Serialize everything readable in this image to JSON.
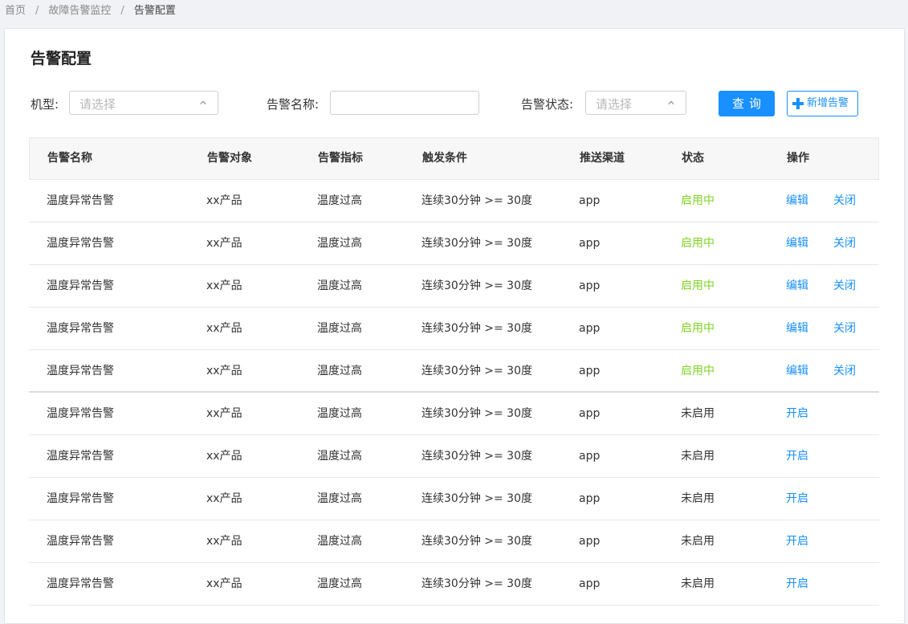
{
  "breadcrumb": {
    "items": [
      "首页",
      "故障告警监控",
      "告警配置"
    ],
    "separator": "/"
  },
  "page": {
    "title": "告警配置"
  },
  "filters": {
    "model_label": "机型:",
    "model_placeholder": "请选择",
    "name_label": "告警名称:",
    "name_value": "",
    "status_label": "告警状态:",
    "status_placeholder": "请选择"
  },
  "buttons": {
    "query": "查询",
    "add": "新增告警"
  },
  "table": {
    "headers": [
      "告警名称",
      "告警对象",
      "告警指标",
      "触发条件",
      "推送渠道",
      "状态",
      "操作"
    ],
    "rows": [
      {
        "name": "温度异常告警",
        "target": "xx产品",
        "metric": "温度过高",
        "condition": "连续30分钟 >= 30度",
        "channel": "app",
        "status": "启用中",
        "action1": "编辑",
        "action2": "关闭"
      },
      {
        "name": "温度异常告警",
        "target": "xx产品",
        "metric": "温度过高",
        "condition": "连续30分钟 >= 30度",
        "channel": "app",
        "status": "启用中",
        "action1": "编辑",
        "action2": "关闭"
      },
      {
        "name": "温度异常告警",
        "target": "xx产品",
        "metric": "温度过高",
        "condition": "连续30分钟 >= 30度",
        "channel": "app",
        "status": "启用中",
        "action1": "编辑",
        "action2": "关闭"
      },
      {
        "name": "温度异常告警",
        "target": "xx产品",
        "metric": "温度过高",
        "condition": "连续30分钟 >= 30度",
        "channel": "app",
        "status": "启用中",
        "action1": "编辑",
        "action2": "关闭"
      },
      {
        "name": "温度异常告警",
        "target": "xx产品",
        "metric": "温度过高",
        "condition": "连续30分钟 >= 30度",
        "channel": "app",
        "status": "启用中",
        "action1": "编辑",
        "action2": "关闭"
      },
      {
        "name": "温度异常告警",
        "target": "xx产品",
        "metric": "温度过高",
        "condition": "连续30分钟 >= 30度",
        "channel": "app",
        "status": "未启用",
        "action1": "开启",
        "action2": ""
      },
      {
        "name": "温度异常告警",
        "target": "xx产品",
        "metric": "温度过高",
        "condition": "连续30分钟 >= 30度",
        "channel": "app",
        "status": "未启用",
        "action1": "开启",
        "action2": ""
      },
      {
        "name": "温度异常告警",
        "target": "xx产品",
        "metric": "温度过高",
        "condition": "连续30分钟 >= 30度",
        "channel": "app",
        "status": "未启用",
        "action1": "开启",
        "action2": ""
      },
      {
        "name": "温度异常告警",
        "target": "xx产品",
        "metric": "温度过高",
        "condition": "连续30分钟 >= 30度",
        "channel": "app",
        "status": "未启用",
        "action1": "开启",
        "action2": ""
      },
      {
        "name": "温度异常告警",
        "target": "xx产品",
        "metric": "温度过高",
        "condition": "连续30分钟 >= 30度",
        "channel": "app",
        "status": "未启用",
        "action1": "开启",
        "action2": ""
      }
    ]
  },
  "colors": {
    "primary": "#1890ff",
    "enabled": "#7ed321",
    "icons": [
      "chevron-up-icon",
      "plus-icon"
    ]
  }
}
